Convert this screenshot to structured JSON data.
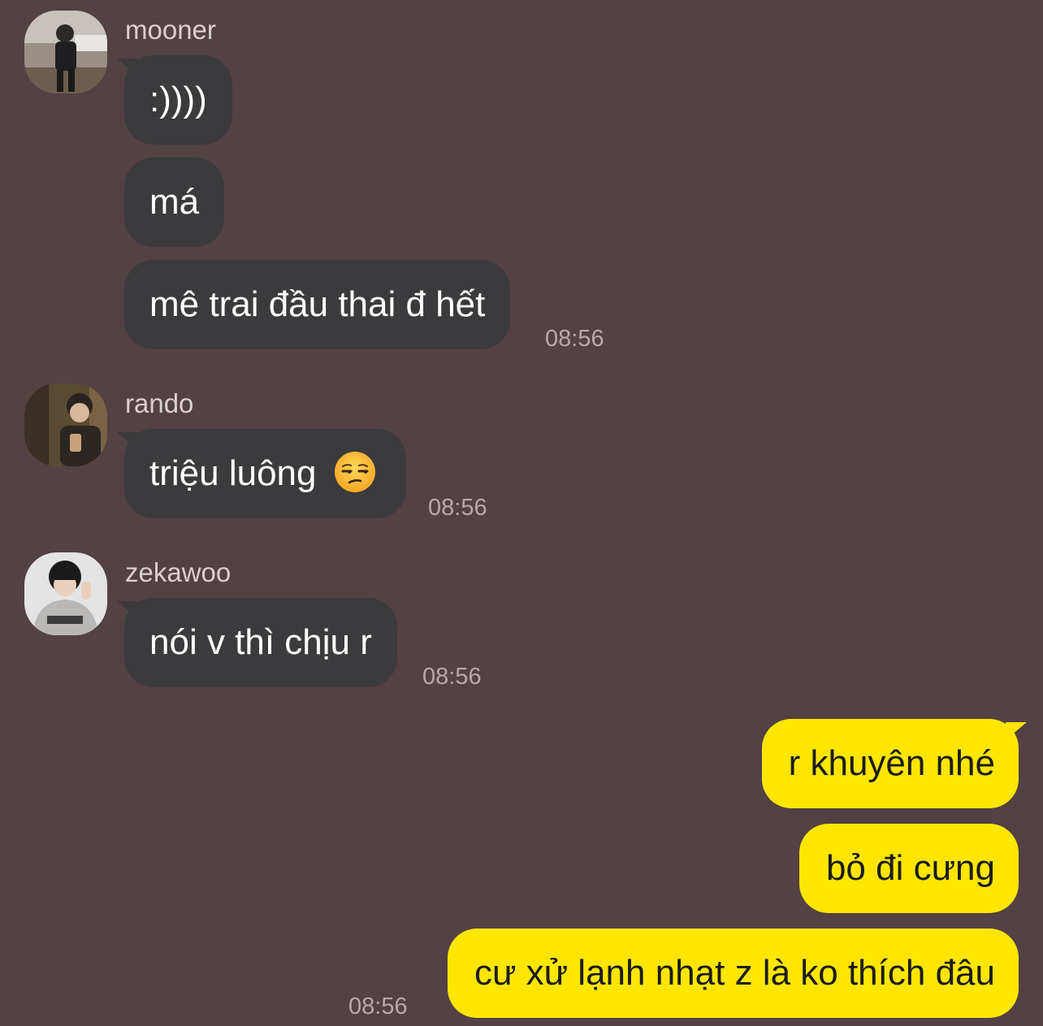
{
  "colors": {
    "background": "#534144",
    "incoming_bubble": "#3b3a3c",
    "outgoing_bubble": "#ffe600",
    "incoming_text": "#ffffff",
    "outgoing_text": "#1c1c1c",
    "sender_name": "#d9cfd1",
    "timestamp": "#b6a9ab"
  },
  "groups": [
    {
      "sender": "mooner",
      "avatar_icon": "user-photo-mooner-icon",
      "messages": [
        ":))))",
        "má",
        "mê trai đầu thai đ hết"
      ],
      "time": "08:56"
    },
    {
      "sender": "rando",
      "avatar_icon": "user-photo-rando-icon",
      "messages": [
        "triệu luông"
      ],
      "emoji": "unamused-face-emoji",
      "time": "08:56"
    },
    {
      "sender": "zekawoo",
      "avatar_icon": "user-photo-zekawoo-icon",
      "messages": [
        "nói v thì chịu r"
      ],
      "time": "08:56"
    },
    {
      "sender": "me",
      "outgoing": true,
      "messages": [
        "r khuyên nhé",
        "bỏ đi cưng",
        "cư xử lạnh nhạt z là ko thích đâu"
      ],
      "time": "08:56"
    }
  ]
}
